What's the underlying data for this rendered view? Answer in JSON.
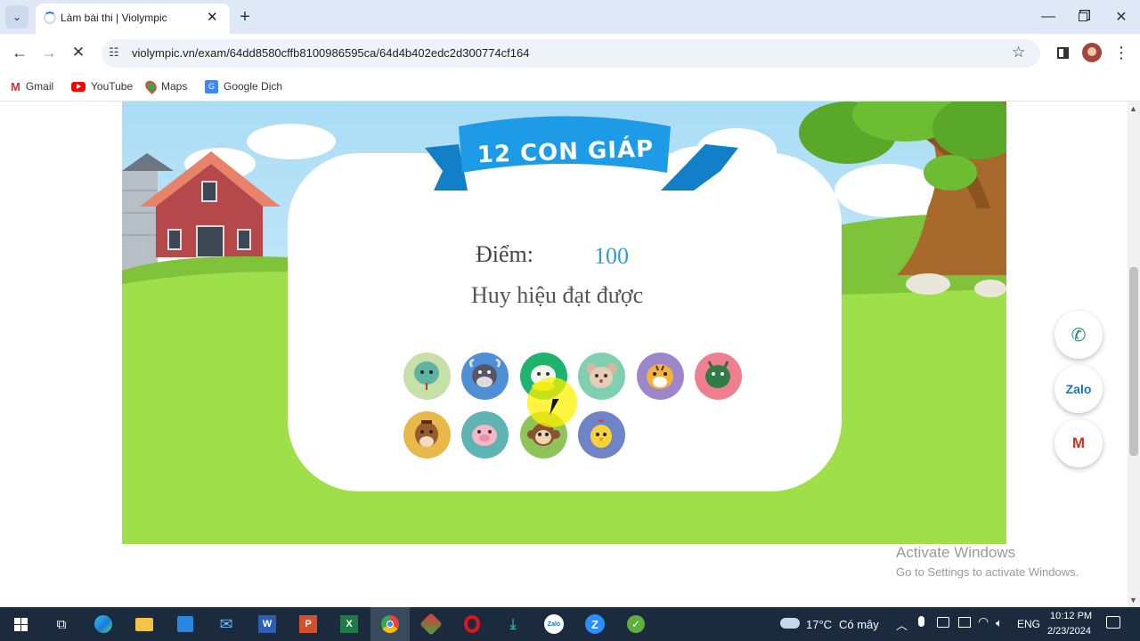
{
  "browser": {
    "tab_title": "Làm bài thi | Violympic",
    "new_tab_symbol": "+",
    "url": "violympic.vn/exam/64dd8580cffb8100986595ca/64d4b402edc2d300774cf164",
    "bookmarks": [
      {
        "label": "Gmail",
        "icon": "gmail-icon"
      },
      {
        "label": "YouTube",
        "icon": "youtube-icon"
      },
      {
        "label": "Maps",
        "icon": "maps-icon"
      },
      {
        "label": "Google Dịch",
        "icon": "translate-icon"
      }
    ]
  },
  "game": {
    "banner_title": "12 CON GIÁP",
    "score_label": "Điểm:",
    "score_value": "100",
    "badges_title": "Huy hiệu đạt được",
    "badges": [
      {
        "animal": "snake",
        "bg": "#c7e0a8"
      },
      {
        "animal": "buffalo",
        "bg": "#4f8fd6"
      },
      {
        "animal": "goat",
        "bg": "#1eb36f"
      },
      {
        "animal": "rat",
        "bg": "#7fd0b0"
      },
      {
        "animal": "tiger",
        "bg": "#9b87c9"
      },
      {
        "animal": "dragon",
        "bg": "#ef7f8f"
      },
      {
        "animal": "horse",
        "bg": "#e8b84a"
      },
      {
        "animal": "pig",
        "bg": "#5fb3b3"
      },
      {
        "animal": "monkey",
        "bg": "#8fc45a"
      },
      {
        "animal": "rooster",
        "bg": "#6f83c9"
      }
    ]
  },
  "side_buttons": {
    "phone_icon": "phone-icon",
    "zalo_label": "Zalo",
    "gmail_icon": "gmail-icon"
  },
  "watermark": {
    "title": "Activate Windows",
    "subtitle": "Go to Settings to activate Windows."
  },
  "taskbar": {
    "weather_temp": "17°C",
    "weather_text": "Có mây",
    "language": "ENG",
    "time": "10:12 PM",
    "date": "2/23/2024"
  },
  "colors": {
    "tabbar": "#dfe8f6",
    "banner": "#1e9be6",
    "score": "#2a9fd6",
    "grass": "#9fe04a",
    "taskbar": "#1b2a3d"
  }
}
